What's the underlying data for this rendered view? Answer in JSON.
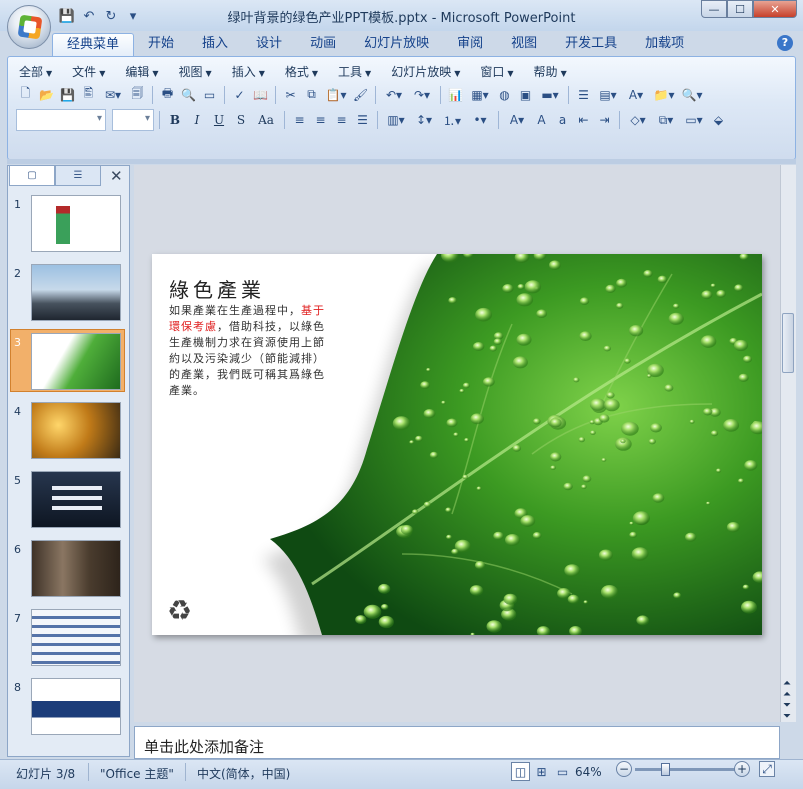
{
  "window": {
    "title": "绿叶背景的绿色产业PPT模板.pptx - Microsoft PowerPoint",
    "min": "—",
    "max": "☐",
    "close": "✕"
  },
  "qat": {
    "save": "💾",
    "undo": "↶",
    "redo": "↻",
    "more": "▾"
  },
  "tabs": [
    "经典菜单",
    "开始",
    "插入",
    "设计",
    "动画",
    "幻灯片放映",
    "审阅",
    "视图",
    "开发工具",
    "加载项"
  ],
  "help": "?",
  "menus": [
    "全部",
    "文件",
    "编辑",
    "视图",
    "插入",
    "格式",
    "工具",
    "幻灯片放映",
    "窗口",
    "帮助"
  ],
  "format_buttons": [
    "B",
    "I",
    "U",
    "S",
    "Aa"
  ],
  "pane": {
    "tab_slides": "▢",
    "tab_outline": "☰",
    "close": "✕"
  },
  "slides": [
    {
      "num": "1",
      "colors": [
        "#ffffff",
        "#ffffff"
      ]
    },
    {
      "num": "2",
      "colors": [
        "#8fb3d6",
        "#2f3a4a"
      ]
    },
    {
      "num": "3",
      "colors": [
        "#ffffff",
        "#2f8a2f"
      ]
    },
    {
      "num": "4",
      "colors": [
        "#c07a18",
        "#3b2a14"
      ]
    },
    {
      "num": "5",
      "colors": [
        "#1d2a3e",
        "#0e1622"
      ]
    },
    {
      "num": "6",
      "colors": [
        "#5a4a3a",
        "#2e241b"
      ]
    },
    {
      "num": "7",
      "colors": [
        "#e8eef7",
        "#4e6fa3"
      ]
    },
    {
      "num": "8",
      "colors": [
        "#ffffff",
        "#1c3d7a"
      ]
    }
  ],
  "slide": {
    "title": "綠色產業",
    "body_pre": "如果產業在生產過程中，",
    "body_red": "基于環保考慮",
    "body_post": "，借助科技，以綠色生產機制力求在資源使用上節約以及污染減少（節能減排）的產業，我們既可稱其爲綠色產業。",
    "recycle": "♻"
  },
  "notes": {
    "placeholder": "单击此处添加备注"
  },
  "status": {
    "slide": "幻灯片 3/8",
    "theme": "\"Office 主题\"",
    "lang": "中文(简体，中国)",
    "zoom": "64%",
    "zoom_level": 64,
    "minus": "−",
    "plus": "+"
  }
}
